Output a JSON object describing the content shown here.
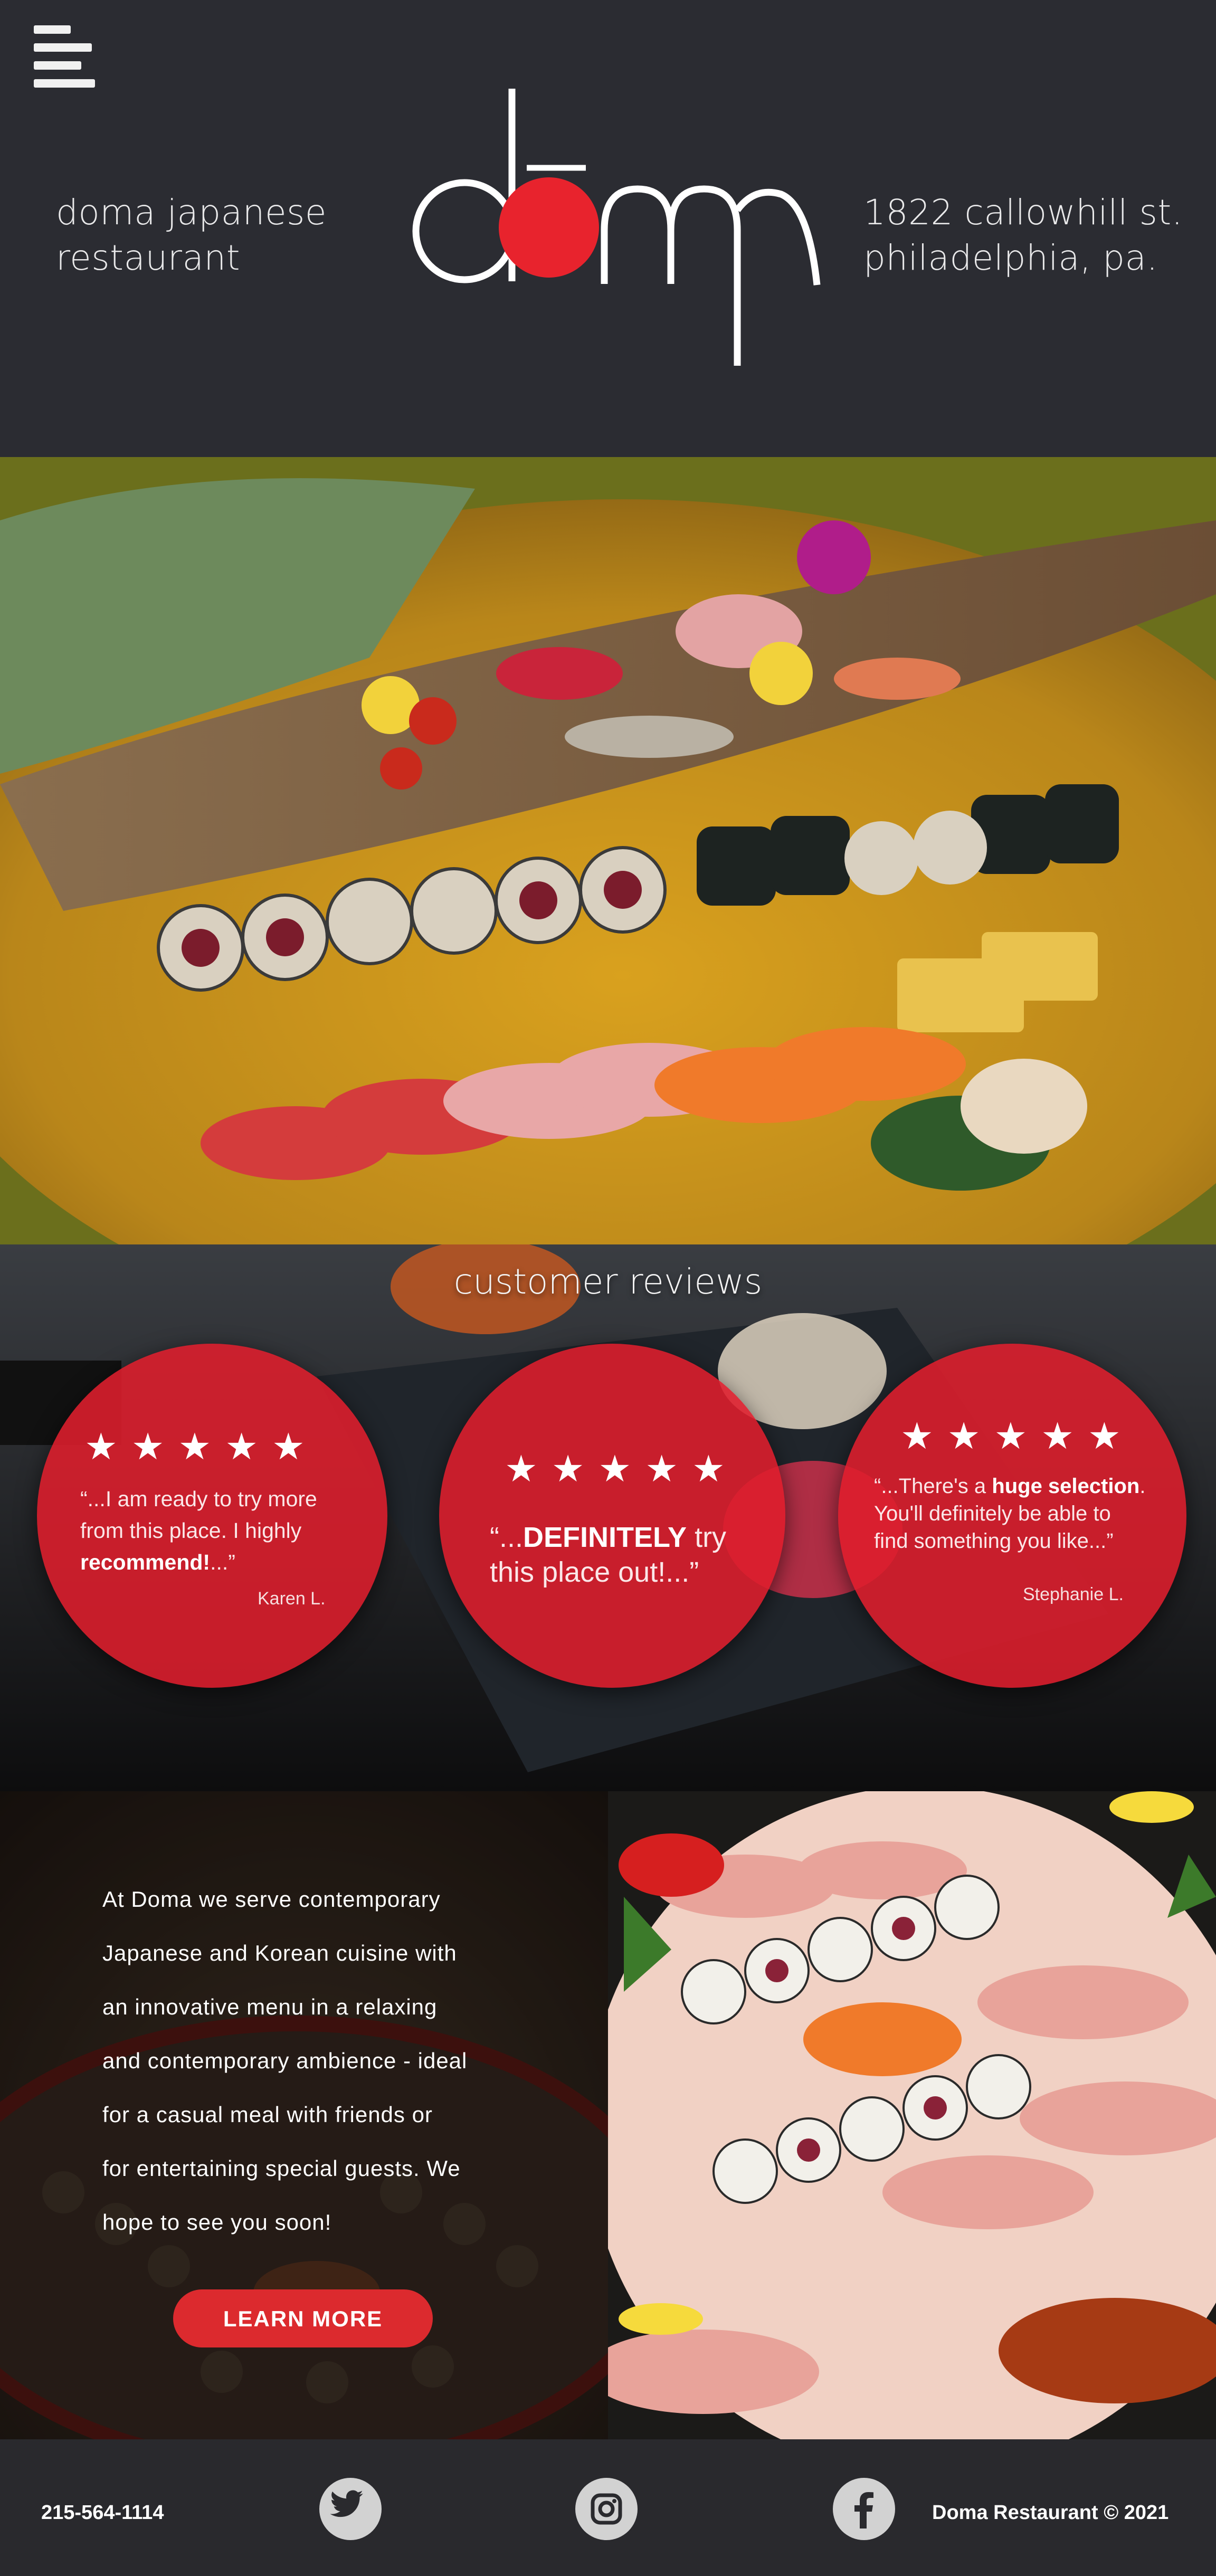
{
  "header": {
    "menu_icon": "hamburger-menu-icon",
    "tagline_left_line1": "doma japanese",
    "tagline_left_line2": "restaurant",
    "tagline_right_line1": "1822 callowhill st.",
    "tagline_right_line2": "philadelphia, pa.",
    "logo_text": "doma"
  },
  "reviews": {
    "title": "customer reviews",
    "stars": "★★★★★",
    "items": [
      {
        "q1": "“...I am ready to try more",
        "q2": "from this place. I highly",
        "q3_bold": "recommend!",
        "q3_rest": "...”",
        "author": "Karen L."
      },
      {
        "q1_pre": "“...",
        "q1_bold": "DEFINITELY",
        "q1_post": " try",
        "q2": "this place out!...”",
        "author": ""
      },
      {
        "q1_pre": "“...There's a ",
        "q1_bold": "huge selection",
        "q1_post": ".",
        "q2": "You'll definitely be able to",
        "q3": "find something you like...”",
        "author": "Stephanie L."
      }
    ]
  },
  "about": {
    "lines": [
      "At Doma we serve contemporary",
      "Japanese and Korean cuisine with",
      "an innovative menu in a relaxing",
      "and contemporary ambience - ideal",
      "for a casual meal with friends or",
      "for entertaining special guests. We",
      "hope to see you soon!"
    ],
    "button": "LEARN MORE"
  },
  "footer": {
    "phone": "215-564-1114",
    "copyright": "Doma Restaurant © 2021",
    "social": [
      "twitter-icon",
      "instagram-icon",
      "facebook-icon"
    ]
  },
  "colors": {
    "background_dark": "#2b2c32",
    "accent_red": "#e8232d",
    "review_circle": "#df1e2c",
    "button_red": "#dc2a2e"
  }
}
